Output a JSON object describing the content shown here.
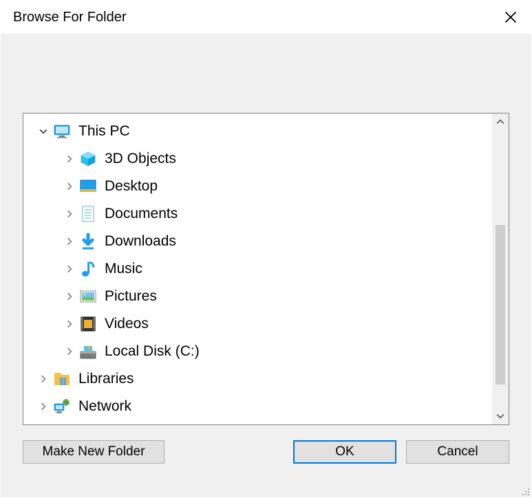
{
  "title": "Browse For Folder",
  "tree": {
    "root": {
      "label": "This PC",
      "expanded": true,
      "children": [
        {
          "label": "3D Objects",
          "icon": "3d-objects"
        },
        {
          "label": "Desktop",
          "icon": "desktop"
        },
        {
          "label": "Documents",
          "icon": "documents"
        },
        {
          "label": "Downloads",
          "icon": "downloads"
        },
        {
          "label": "Music",
          "icon": "music"
        },
        {
          "label": "Pictures",
          "icon": "pictures"
        },
        {
          "label": "Videos",
          "icon": "videos"
        },
        {
          "label": "Local Disk (C:)",
          "icon": "disk"
        }
      ]
    },
    "siblings": [
      {
        "label": "Libraries",
        "icon": "libraries"
      },
      {
        "label": "Network",
        "icon": "network"
      }
    ]
  },
  "buttons": {
    "make_new_folder": "Make New Folder",
    "ok": "OK",
    "cancel": "Cancel"
  }
}
